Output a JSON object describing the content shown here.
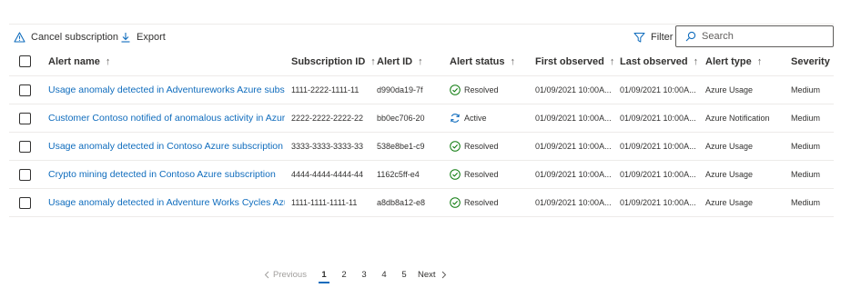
{
  "toolbar": {
    "cancel_label": "Cancel subscription",
    "cancel_icon": "warning-icon",
    "export_label": "Export",
    "export_icon": "download-icon",
    "filter_label": "Filter",
    "filter_icon": "filter-icon",
    "search_placeholder": "Search",
    "search_icon": "search-icon"
  },
  "columns": {
    "name": "Alert name",
    "subscription_id": "Subscription ID",
    "alert_id": "Alert ID",
    "status": "Alert status",
    "first_observed": "First observed",
    "last_observed": "Last observed",
    "type": "Alert type",
    "severity": "Severity",
    "sort_glyph": "↑"
  },
  "rows": [
    {
      "name": "Usage anomaly detected in Adventureworks Azure subscription",
      "subscription_id": "1111-2222-1111-11",
      "alert_id": "d990da19-7f",
      "status": "Resolved",
      "status_icon": "check-circle-icon",
      "first_observed": "01/09/2021 10:00A...",
      "last_observed": "01/09/2021 10:00A...",
      "type": "Azure Usage",
      "severity": "Medium"
    },
    {
      "name": "Customer Contoso notified of anomalous activity in Azure",
      "subscription_id": "2222-2222-2222-22",
      "alert_id": "bb0ec706-20",
      "status": "Active",
      "status_icon": "sync-icon",
      "first_observed": "01/09/2021 10:00A...",
      "last_observed": "01/09/2021 10:00A...",
      "type": "Azure Notification",
      "severity": "Medium"
    },
    {
      "name": "Usage anomaly detected in Contoso Azure subscription",
      "subscription_id": "3333-3333-3333-33",
      "alert_id": "538e8be1-c9",
      "status": "Resolved",
      "status_icon": "check-circle-icon",
      "first_observed": "01/09/2021 10:00A...",
      "last_observed": "01/09/2021 10:00A...",
      "type": "Azure Usage",
      "severity": "Medium"
    },
    {
      "name": "Crypto mining detected in Contoso Azure subscription",
      "subscription_id": "4444-4444-4444-44",
      "alert_id": "1162c5ff-e4",
      "status": "Resolved",
      "status_icon": "check-circle-icon",
      "first_observed": "01/09/2021 10:00A...",
      "last_observed": "01/09/2021 10:00A...",
      "type": "Azure Usage",
      "severity": "Medium"
    },
    {
      "name": "Usage anomaly detected in Adventure Works Cycles Azure subscription",
      "subscription_id": "1111-1111-1111-11",
      "alert_id": "a8db8a12-e8",
      "status": "Resolved",
      "status_icon": "check-circle-icon",
      "first_observed": "01/09/2021 10:00A...",
      "last_observed": "01/09/2021 10:00A...",
      "type": "Azure Usage",
      "severity": "Medium"
    }
  ],
  "pagination": {
    "previous_label": "Previous",
    "next_label": "Next",
    "pages": [
      "1",
      "2",
      "3",
      "4",
      "5"
    ],
    "current_page": "1"
  },
  "colors": {
    "accent": "#0f6cbd",
    "resolved": "#107c10",
    "active": "#0f6cbd",
    "divider": "#edebe9"
  }
}
